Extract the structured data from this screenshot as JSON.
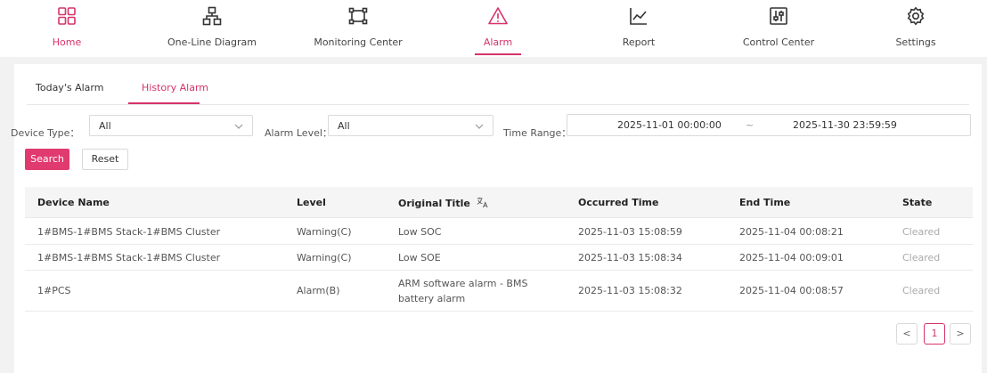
{
  "nav": {
    "items": [
      {
        "label": "Home",
        "icon": "grid-icon"
      },
      {
        "label": "One-Line Diagram",
        "icon": "network-icon"
      },
      {
        "label": "Monitoring Center",
        "icon": "monitor-frame-icon"
      },
      {
        "label": "Alarm",
        "icon": "warning-icon"
      },
      {
        "label": "Report",
        "icon": "line-chart-icon"
      },
      {
        "label": "Control Center",
        "icon": "sliders-icon"
      },
      {
        "label": "Settings",
        "icon": "gear-icon"
      }
    ],
    "active": "Alarm",
    "accent_color": "#d6326b"
  },
  "tabs": {
    "items": [
      "Today's Alarm",
      "History Alarm"
    ],
    "active": "History Alarm"
  },
  "filters": {
    "device_type_label": "Device Type：",
    "device_type_value": "All",
    "alarm_level_label": "Alarm Level：",
    "alarm_level_value": "All",
    "time_range_label": "Time Range：",
    "time_start": "2025-11-01 00:00:00",
    "time_separator": "~",
    "time_end": "2025-11-30 23:59:59"
  },
  "buttons": {
    "search": "Search",
    "reset": "Reset",
    "search_color": "#e03a6e"
  },
  "table": {
    "columns": [
      "Device Name",
      "Level",
      "Original Title",
      "Occurred Time",
      "End Time",
      "State"
    ],
    "rows": [
      {
        "device": "1#BMS-1#BMS Stack-1#BMS Cluster",
        "level": "Warning(C)",
        "title": "Low SOC",
        "occurred": "2025-11-03 15:08:59",
        "end": "2025-11-04 00:08:21",
        "state": "Cleared"
      },
      {
        "device": "1#BMS-1#BMS Stack-1#BMS Cluster",
        "level": "Warning(C)",
        "title": "Low SOE",
        "occurred": "2025-11-03 15:08:34",
        "end": "2025-11-04 00:09:01",
        "state": "Cleared"
      },
      {
        "device": "1#PCS",
        "level": "Alarm(B)",
        "title": "ARM software alarm - BMS battery alarm",
        "occurred": "2025-11-03 15:08:32",
        "end": "2025-11-04 00:08:57",
        "state": "Cleared"
      }
    ]
  },
  "pagination": {
    "prev": "<",
    "current": "1",
    "next": ">"
  }
}
